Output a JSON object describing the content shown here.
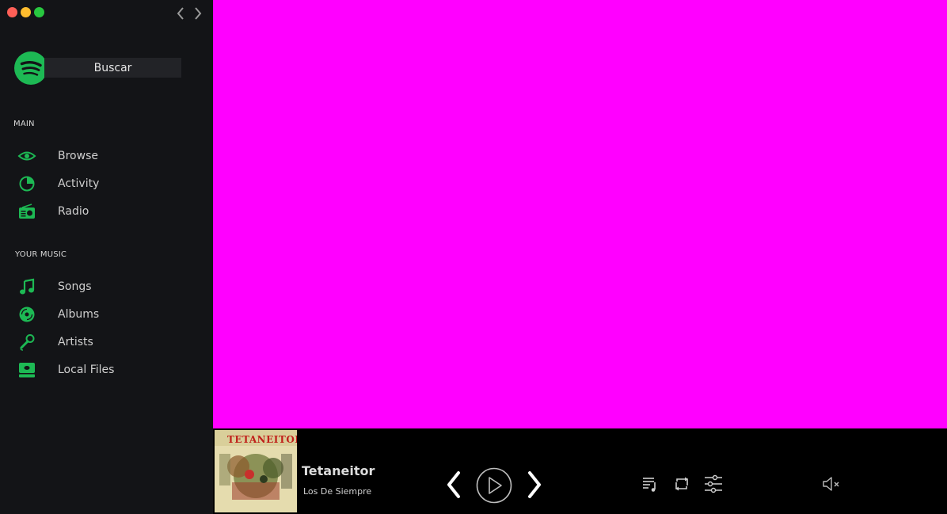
{
  "sidebar": {
    "search": {
      "value": "Buscar"
    },
    "sections": [
      {
        "title": "MAIN",
        "items": [
          {
            "label": "Browse",
            "icon": "eye-icon"
          },
          {
            "label": "Activity",
            "icon": "pie-icon"
          },
          {
            "label": "Radio",
            "icon": "radio-icon"
          }
        ]
      },
      {
        "title": "YOUR MUSIC",
        "items": [
          {
            "label": "Songs",
            "icon": "music-note-icon"
          },
          {
            "label": "Albums",
            "icon": "disc-icon"
          },
          {
            "label": "Artists",
            "icon": "microphone-icon"
          },
          {
            "label": "Local Files",
            "icon": "hard-drive-icon"
          }
        ]
      }
    ]
  },
  "player": {
    "title": "Tetaneitor",
    "artist": "Los De Siempre",
    "cover_text": "TETANEITOR"
  },
  "colors": {
    "accent": "#1db954",
    "sidebar_bg": "#131417",
    "main_bg": "#ff00ff",
    "player_bg": "#000000"
  }
}
